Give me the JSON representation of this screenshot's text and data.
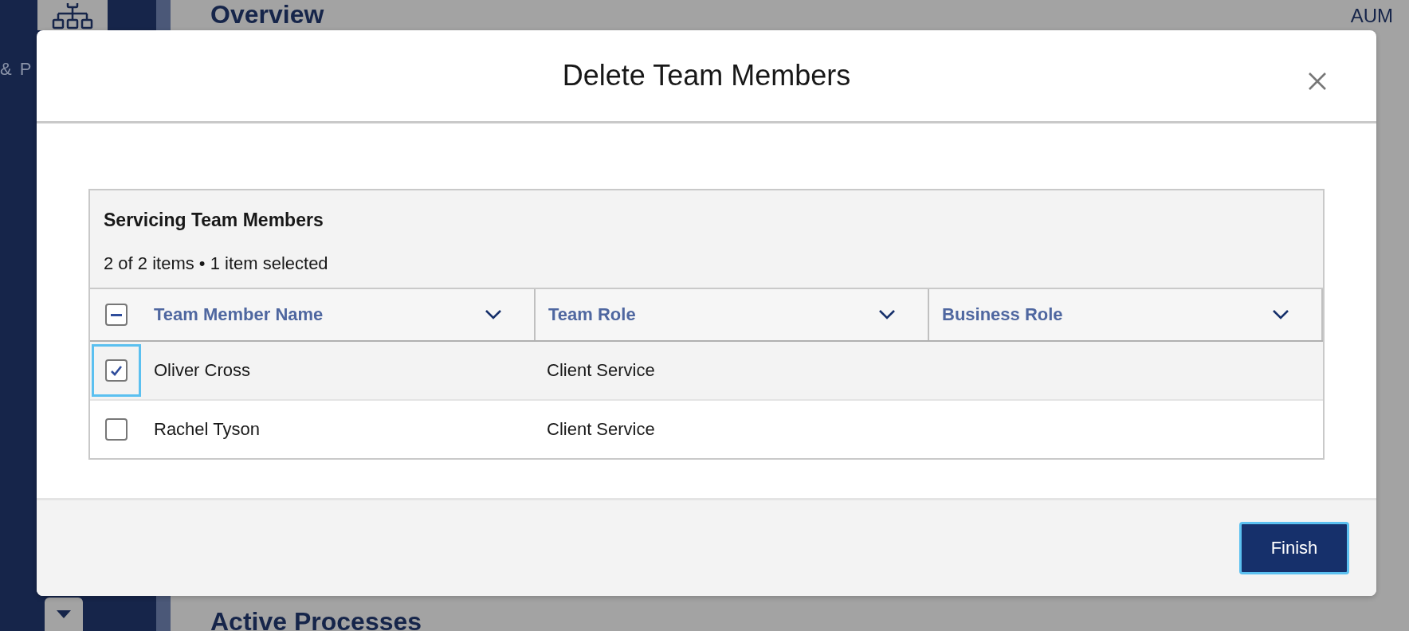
{
  "background": {
    "sidebar_fragments": [
      "& P"
    ],
    "page_title": "Overview",
    "aum_label": "AUM",
    "section_title": "Active Processes"
  },
  "dialog": {
    "title": "Delete Team Members",
    "table": {
      "title": "Servicing Team Members",
      "summary": "2 of 2 items • 1 item selected",
      "select_all": {
        "indeterminate": true
      },
      "columns": [
        {
          "label": "Team Member Name"
        },
        {
          "label": "Team Role"
        },
        {
          "label": "Business Role"
        }
      ],
      "rows": [
        {
          "checked": true,
          "focused": true,
          "name": "Oliver Cross",
          "team_role": "Client Service"
        },
        {
          "checked": false,
          "focused": false,
          "name": "Rachel Tyson",
          "team_role": "Client Service"
        }
      ]
    },
    "buttons": [
      {
        "label": "Finish",
        "focused": true
      }
    ]
  }
}
